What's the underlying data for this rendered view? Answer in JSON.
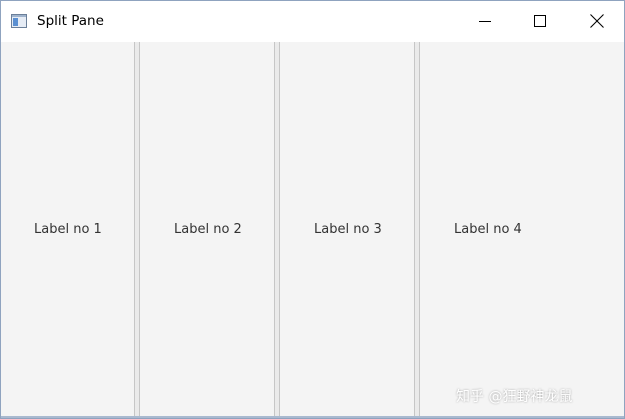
{
  "window": {
    "title": "Split Pane",
    "app_icon": "window-icon",
    "controls": {
      "minimize_icon": "minimize-icon",
      "maximize_icon": "maximize-icon",
      "close_icon": "close-icon"
    }
  },
  "panes": [
    {
      "label": "Label no 1"
    },
    {
      "label": "Label no 2"
    },
    {
      "label": "Label no 3"
    },
    {
      "label": "Label no 4"
    }
  ],
  "watermark": "知乎 @狂野神龙鼠",
  "colors": {
    "pane_background": "#f4f4f4",
    "divider": "#eaeaea",
    "window_border": "#8fa3bf"
  }
}
